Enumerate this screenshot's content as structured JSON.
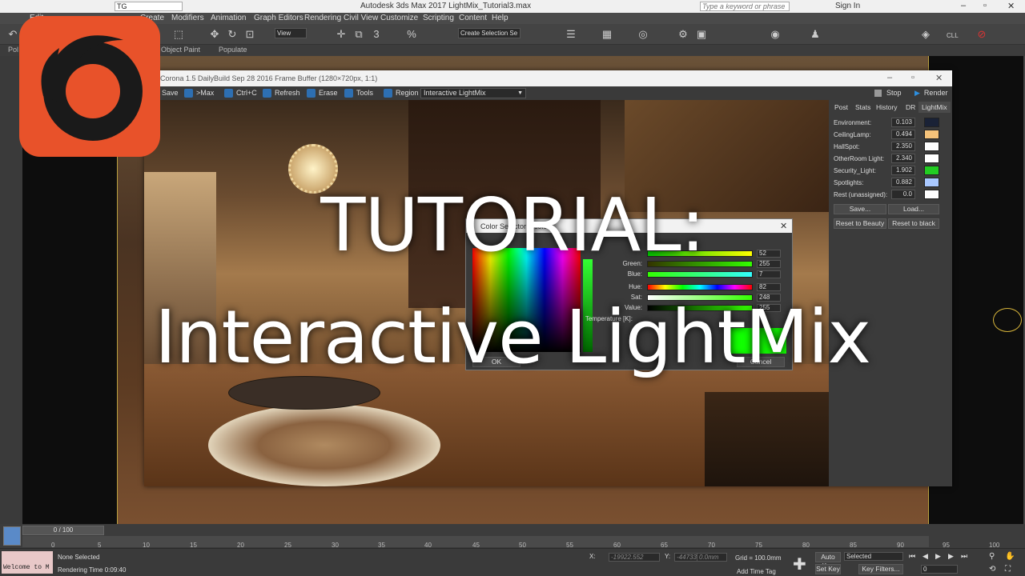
{
  "app": {
    "title": "Autodesk 3ds Max 2017    LightMix_Tutorial3.max",
    "workspace": "TG",
    "search_placeholder": "Type a keyword or phrase",
    "sign_in": "Sign In"
  },
  "menu": [
    "Edit",
    "Create",
    "Modifiers",
    "Animation",
    "Graph Editors",
    "Rendering",
    "Civil View",
    "Customize",
    "Scripting",
    "Content",
    "Help"
  ],
  "toolbar": {
    "view_dropdown": "View",
    "selection_set": "Create Selection Se",
    "cll": "CLL"
  },
  "ribbon": [
    "Pol",
    "Object Paint",
    "Populate"
  ],
  "framebuffer": {
    "title": "Corona 1.5 DailyBuild Sep 28 2016 Frame Buffer (1280×720px, 1:1)",
    "buttons": [
      "Save",
      ">Max",
      "Ctrl+C",
      "Refresh",
      "Erase",
      "Tools",
      "Region"
    ],
    "mode": "Interactive LightMix",
    "stop": "Stop",
    "render": "Render",
    "tabs": [
      "Post",
      "Stats",
      "History",
      "DR",
      "LightMix"
    ],
    "lightmix": [
      {
        "label": "Environment:",
        "value": "0.103",
        "color": "#1a2236"
      },
      {
        "label": "CeilingLamp:",
        "value": "0.494",
        "color": "#f5c27a"
      },
      {
        "label": "HallSpot:",
        "value": "2.350",
        "color": "#ffffff"
      },
      {
        "label": "OtherRoom Light:",
        "value": "2.340",
        "color": "#ffffff"
      },
      {
        "label": "Security_Light:",
        "value": "1.902",
        "color": "#22cc22"
      },
      {
        "label": "Spotlights:",
        "value": "0.882",
        "color": "#a9c8ff"
      },
      {
        "label": "Rest (unassigned):",
        "value": "0.0",
        "color": "#ffffff"
      }
    ],
    "save": "Save...",
    "load": "Load...",
    "reset_beauty": "Reset to Beauty",
    "reset_black": "Reset to black"
  },
  "color_selector": {
    "title": "Color Selector: Lcolor",
    "rows": [
      {
        "label": "Green:",
        "value": "255"
      },
      {
        "label": "Blue:",
        "value": "7"
      },
      {
        "label": "Hue:",
        "value": "82"
      },
      {
        "label": "Sat:",
        "value": "248"
      },
      {
        "label": "Value:",
        "value": "255"
      }
    ],
    "red_value": "52",
    "temperature_label": "Temperature [K]:",
    "ok": "OK",
    "cancel": "Cancel"
  },
  "overlay": {
    "line1": "TUTORIAL:",
    "line2": "Interactive LightMix"
  },
  "timeline": {
    "frame": "0 / 100",
    "ticks": [
      "0",
      "5",
      "10",
      "15",
      "20",
      "25",
      "30",
      "35",
      "40",
      "45",
      "50",
      "55",
      "60",
      "65",
      "70",
      "75",
      "80",
      "85",
      "90",
      "95",
      "100"
    ]
  },
  "status": {
    "listener": "Welcome to M",
    "selected": "None Selected",
    "render_time": "Rendering Time  0:09:40",
    "x": "-19922.552",
    "y": "-44733.31",
    "z": "0.0mm",
    "grid": "Grid = 100.0mm",
    "add_time_tag": "Add Time Tag",
    "auto_key": "Auto Key",
    "set_key": "Set Key",
    "selected_mode": "Selected",
    "key_filters": "Key Filters...",
    "frame_field": "0"
  },
  "colors": {
    "accent": "#2d6fb2",
    "logo": "#e8522a"
  }
}
